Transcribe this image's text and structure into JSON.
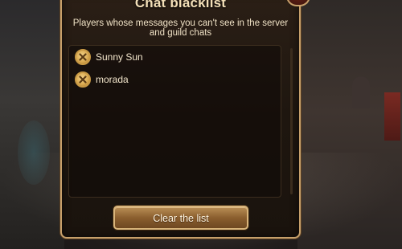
{
  "dialog": {
    "title": "Chat blacklist",
    "subtitle": "Players whose messages you can't see in the server and guild chats",
    "blacklist": [
      {
        "name": "Sunny Sun"
      },
      {
        "name": "morada"
      }
    ],
    "clear_button_label": "Clear the list"
  },
  "icons": {
    "remove": "close-icon",
    "dialog_close": "close-icon"
  },
  "colors": {
    "frame": "#c7a06b",
    "panel_bg": "#1e160f",
    "text": "#f3e6cc",
    "button": "#8b5f2f",
    "remove_button": "#d8a84f"
  }
}
